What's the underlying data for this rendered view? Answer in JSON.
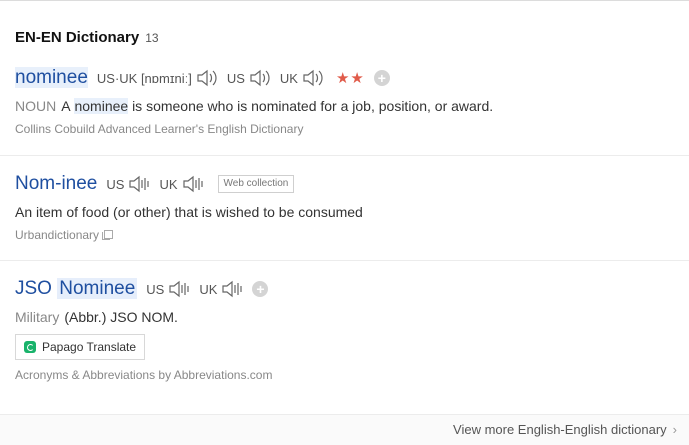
{
  "header": {
    "title": "EN-EN Dictionary",
    "count": "13"
  },
  "entries": [
    {
      "word": "nominee",
      "pron_us_uk": "US·UK [nɒmɪniː]",
      "us": "US",
      "uk": "UK",
      "stars": "★★",
      "pos": "NOUN",
      "def_pre": "A",
      "def_hl": "nominee",
      "def_post": "is someone who is nominated for a job, position, or award.",
      "source": "Collins Cobuild Advanced Learner's English Dictionary"
    },
    {
      "word": "Nom-inee",
      "us": "US",
      "uk": "UK",
      "badge": "Web collection",
      "def": "An item of food (or other) that is wished to be consumed",
      "source": "Urbandictionary"
    },
    {
      "word_a": "JSO",
      "word_b": "Nominee",
      "us": "US",
      "uk": "UK",
      "pos": "Military",
      "def": "(Abbr.) JSO NOM.",
      "papago": "Papago Translate",
      "source": "Acronyms & Abbreviations by Abbreviations.com"
    }
  ],
  "footer": {
    "more": "View more English-English dictionary"
  },
  "colors": {
    "word": "#1f4fa0",
    "stars": "#e05b4a",
    "papago": "#19b36b"
  },
  "icons": [
    "speaker-icon",
    "plus-icon",
    "copy-icon",
    "papago-icon",
    "chevron-right-icon"
  ]
}
